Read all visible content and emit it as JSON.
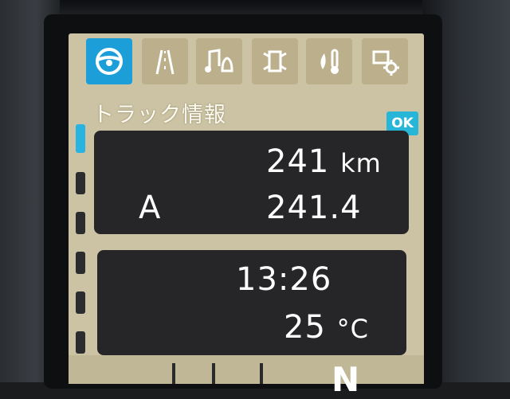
{
  "screen": {
    "title": "トラック情報",
    "ok_label": "OK",
    "icons": [
      {
        "name": "steering-wheel-icon",
        "active": true
      },
      {
        "name": "road-icon",
        "active": false
      },
      {
        "name": "music-bell-icon",
        "active": false
      },
      {
        "name": "truck-settings-icon",
        "active": false
      },
      {
        "name": "temperature-icon",
        "active": false
      },
      {
        "name": "gear-settings-icon",
        "active": false
      }
    ]
  },
  "trip_panel": {
    "distance_value": "241",
    "distance_unit": "km",
    "trip_label": "A",
    "trip_value": "241.4"
  },
  "info_panel": {
    "time": "13:26",
    "temperature_value": "25",
    "temperature_unit": "°C"
  },
  "gear": {
    "indicator": "N"
  },
  "colors": {
    "screen_bg": "#cbc3a3",
    "active_accent": "#1c9ed8",
    "panel_bg": "#262628"
  }
}
